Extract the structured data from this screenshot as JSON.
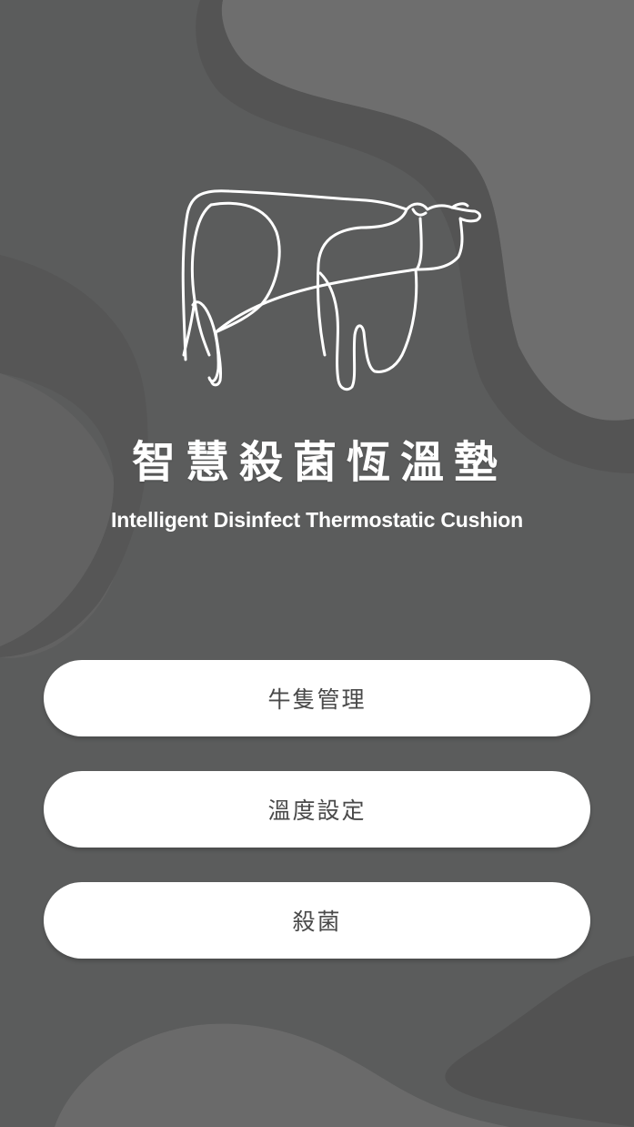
{
  "app": {
    "title_cn": "智慧殺菌恆溫墊",
    "title_en": "Intelligent Disinfect Thermostatic Cushion",
    "logo_icon": "cow-line-art-icon"
  },
  "menu": {
    "items": [
      {
        "label": "牛隻管理"
      },
      {
        "label": "溫度設定"
      },
      {
        "label": "殺菌"
      }
    ]
  },
  "colors": {
    "background": "#5b5c5c",
    "blob_light": "#6e6e6e",
    "blob_dark": "#505050",
    "button_bg": "#ffffff",
    "button_text": "#4a4a4a",
    "title_text": "#ffffff"
  }
}
